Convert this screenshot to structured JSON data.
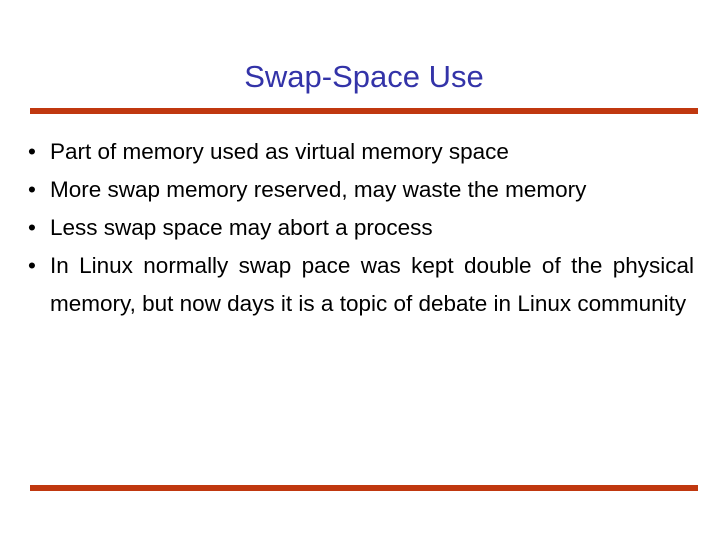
{
  "slide": {
    "title": "Swap-Space Use",
    "title_color": "#3333A8",
    "background_color": "#FFFFFF",
    "body_text_color": "#000000",
    "rule_color": "#C0380F",
    "bullet_glyph": "•",
    "bullets": [
      {
        "text": "Part of memory used as virtual memory space",
        "wraps": false
      },
      {
        "text": "More swap memory reserved, may waste the memory",
        "wraps": true
      },
      {
        "text": "Less swap space may abort a process",
        "wraps": false
      },
      {
        "text": "In Linux normally swap pace was kept double of the physical memory, but now days it is a topic of debate in Linux community",
        "wraps": true
      }
    ]
  }
}
